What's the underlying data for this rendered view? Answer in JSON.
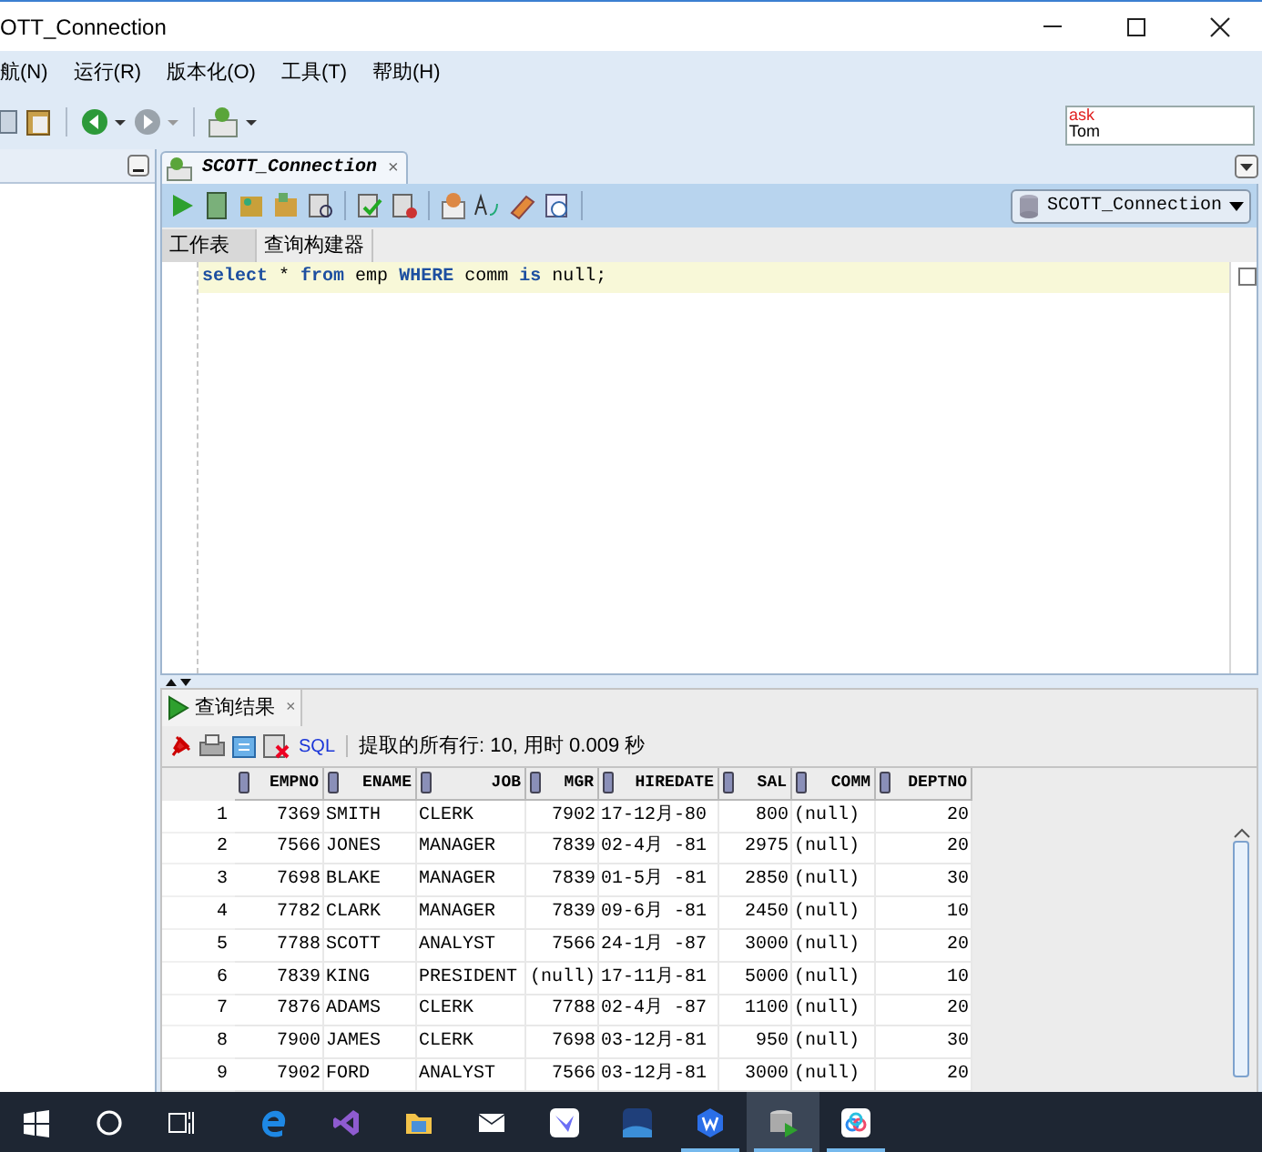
{
  "window": {
    "title": "OTT_Connection"
  },
  "menu": [
    "航(N)",
    "运行(R)",
    "版本化(O)",
    "工具(T)",
    "帮助(H)"
  ],
  "preview": {
    "line_1": "ask",
    "line_2": "Tom"
  },
  "editor_tab": {
    "label": "SCOTT_Connection",
    "close": "×"
  },
  "connection_select": {
    "value": "SCOTT_Connection"
  },
  "sub_tabs": [
    {
      "label": "工作表",
      "selected": true
    },
    {
      "label": "查询构建器",
      "selected": false
    }
  ],
  "sql": [
    {
      "kind": "keyword",
      "text": "select"
    },
    {
      "kind": "plain",
      "text": "*"
    },
    {
      "kind": "keyword",
      "text": "from"
    },
    {
      "kind": "plain",
      "text": "emp"
    },
    {
      "kind": "keyword",
      "text": "WHERE"
    },
    {
      "kind": "plain",
      "text": "comm"
    },
    {
      "kind": "keyword",
      "text": "is"
    },
    {
      "kind": "plain",
      "text": "null;"
    }
  ],
  "results_tab": {
    "label": "查询结果",
    "close": "×"
  },
  "results_toolbar": {
    "sql_link": "SQL",
    "status": "提取的所有行: 10, 用时 0.009 秒"
  },
  "margin_checkbox": {
    "checked": false
  },
  "table": {
    "columns": [
      {
        "label": "EMPNO"
      },
      {
        "label": "ENAME"
      },
      {
        "label": "JOB"
      },
      {
        "label": "MGR"
      },
      {
        "label": "HIREDATE"
      },
      {
        "label": "SAL"
      },
      {
        "label": "COMM"
      },
      {
        "label": "DEPTNO"
      }
    ],
    "rows": [
      {
        "num": "1",
        "cells": [
          "7369",
          "SMITH",
          "CLERK",
          "7902",
          "17-12月-80",
          "800",
          "(null)",
          "20"
        ]
      },
      {
        "num": "2",
        "cells": [
          "7566",
          "JONES",
          "MANAGER",
          "7839",
          "02-4月 -81",
          "2975",
          "(null)",
          "20"
        ]
      },
      {
        "num": "3",
        "cells": [
          "7698",
          "BLAKE",
          "MANAGER",
          "7839",
          "01-5月 -81",
          "2850",
          "(null)",
          "30"
        ]
      },
      {
        "num": "4",
        "cells": [
          "7782",
          "CLARK",
          "MANAGER",
          "7839",
          "09-6月 -81",
          "2450",
          "(null)",
          "10"
        ]
      },
      {
        "num": "5",
        "cells": [
          "7788",
          "SCOTT",
          "ANALYST",
          "7566",
          "24-1月 -87",
          "3000",
          "(null)",
          "20"
        ]
      },
      {
        "num": "6",
        "cells": [
          "7839",
          "KING",
          "PRESIDENT",
          "(null)",
          "17-11月-81",
          "5000",
          "(null)",
          "10"
        ]
      },
      {
        "num": "7",
        "cells": [
          "7876",
          "ADAMS",
          "CLERK",
          "7788",
          "02-4月 -87",
          "1100",
          "(null)",
          "20"
        ]
      },
      {
        "num": "8",
        "cells": [
          "7900",
          "JAMES",
          "CLERK",
          "7698",
          "03-12月-81",
          "950",
          "(null)",
          "30"
        ]
      },
      {
        "num": "9",
        "cells": [
          "7902",
          "FORD",
          "ANALYST",
          "7566",
          "03-12月-81",
          "3000",
          "(null)",
          "20"
        ]
      }
    ]
  },
  "taskbar": [
    {
      "kind": "windows",
      "running": false,
      "active": false
    },
    {
      "kind": "search",
      "running": false,
      "active": false
    },
    {
      "kind": "taskview",
      "running": false,
      "active": false
    },
    {
      "kind": "edge",
      "running": false,
      "active": false
    },
    {
      "kind": "vs",
      "running": false,
      "active": false
    },
    {
      "kind": "folder",
      "running": false,
      "active": false
    },
    {
      "kind": "mail",
      "running": false,
      "active": false
    },
    {
      "kind": "bird",
      "running": false,
      "active": false
    },
    {
      "kind": "tile",
      "running": false,
      "active": false
    },
    {
      "kind": "wps",
      "running": true,
      "active": false
    },
    {
      "kind": "db",
      "running": true,
      "active": true
    },
    {
      "kind": "cloud",
      "running": true,
      "active": false
    }
  ]
}
